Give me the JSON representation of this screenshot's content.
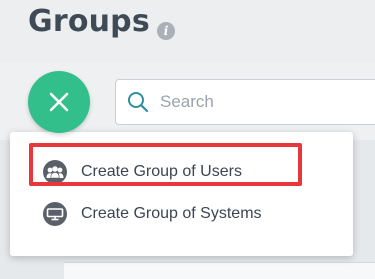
{
  "page": {
    "title": "Groups",
    "info_icon": "info-icon"
  },
  "toolbar": {
    "close_button_icon": "close-icon",
    "accent_color": "#33bf8c"
  },
  "search": {
    "placeholder": "Search",
    "value": ""
  },
  "menu": {
    "items": [
      {
        "label": "Create Group of Users",
        "icon": "user-group-icon",
        "highlighted": true
      },
      {
        "label": "Create Group of Systems",
        "icon": "system-group-icon",
        "highlighted": false
      }
    ]
  },
  "highlight_color": "#e8363d"
}
